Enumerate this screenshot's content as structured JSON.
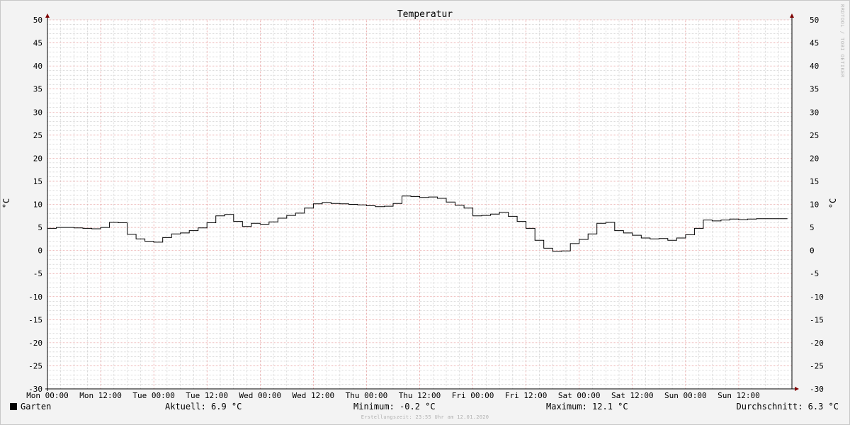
{
  "chart_data": {
    "type": "line",
    "title": "Temperatur",
    "ylabel": "°C",
    "ylim": [
      -30,
      50
    ],
    "y_ticks": [
      50,
      45,
      40,
      35,
      30,
      25,
      20,
      15,
      10,
      5,
      0,
      -5,
      -10,
      -15,
      -20,
      -25,
      -30
    ],
    "x_ticks": [
      "Mon 00:00",
      "Mon 12:00",
      "Tue 00:00",
      "Tue 12:00",
      "Wed 00:00",
      "Wed 12:00",
      "Thu 00:00",
      "Thu 12:00",
      "Fri 00:00",
      "Fri 12:00",
      "Sat 00:00",
      "Sat 12:00",
      "Sun 00:00",
      "Sun 12:00"
    ],
    "x_unit": "hours since Mon 00:00",
    "xlim": [
      0,
      168
    ],
    "grid": true,
    "series": [
      {
        "name": "Garten",
        "color": "#000000",
        "x": [
          0,
          2,
          4,
          6,
          8,
          10,
          12,
          14,
          16,
          18,
          20,
          22,
          24,
          26,
          28,
          30,
          32,
          34,
          36,
          38,
          40,
          42,
          44,
          46,
          48,
          50,
          52,
          54,
          56,
          58,
          60,
          62,
          64,
          66,
          68,
          70,
          72,
          74,
          76,
          78,
          80,
          82,
          84,
          86,
          88,
          90,
          92,
          94,
          96,
          98,
          100,
          102,
          104,
          106,
          108,
          110,
          112,
          114,
          116,
          118,
          120,
          122,
          124,
          126,
          128,
          130,
          132,
          134,
          136,
          138,
          140,
          142,
          144,
          146,
          148,
          150,
          152,
          154,
          156,
          158,
          160,
          162,
          164,
          166,
          167
        ],
        "values": [
          4.8,
          5.0,
          5.0,
          4.9,
          4.8,
          4.7,
          5.0,
          6.1,
          6.0,
          3.5,
          2.5,
          2.0,
          1.8,
          2.8,
          3.6,
          3.8,
          4.3,
          4.9,
          6.0,
          7.5,
          7.8,
          6.3,
          5.2,
          5.9,
          5.7,
          6.2,
          7.0,
          7.6,
          8.1,
          9.2,
          10.1,
          10.4,
          10.2,
          10.1,
          10.0,
          9.9,
          9.7,
          9.5,
          9.6,
          10.2,
          11.8,
          11.7,
          11.5,
          11.6,
          11.3,
          10.5,
          9.8,
          9.2,
          7.5,
          7.6,
          7.9,
          8.3,
          7.4,
          6.3,
          4.8,
          2.2,
          0.5,
          -0.2,
          -0.1,
          1.5,
          2.4,
          3.6,
          5.9,
          6.1,
          4.3,
          3.8,
          3.3,
          2.7,
          2.5,
          2.6,
          2.2,
          2.7,
          3.4,
          4.8,
          6.6,
          6.4,
          6.6,
          6.8,
          6.7,
          6.8,
          6.9,
          6.9,
          6.9,
          6.9,
          6.9
        ]
      }
    ]
  },
  "legend": {
    "series_name": "Garten",
    "aktuell": "Aktuell: 6.9 °C",
    "minimum": "Minimum: -0.2 °C",
    "maximum": "Maximum: 12.1 °C",
    "durchschnitt": "Durchschnitt: 6.3 °C"
  },
  "footer": "Erstellungszeit: 23:55 Uhr am 12.01.2020",
  "watermark": "RRDTOOL / TOBI OETIKER",
  "colors": {
    "major_grid": "#e08080",
    "minor_grid": "#b8b8b8",
    "plot_bg": "#ffffff",
    "axis": "#000000",
    "arrow": "#800000"
  }
}
